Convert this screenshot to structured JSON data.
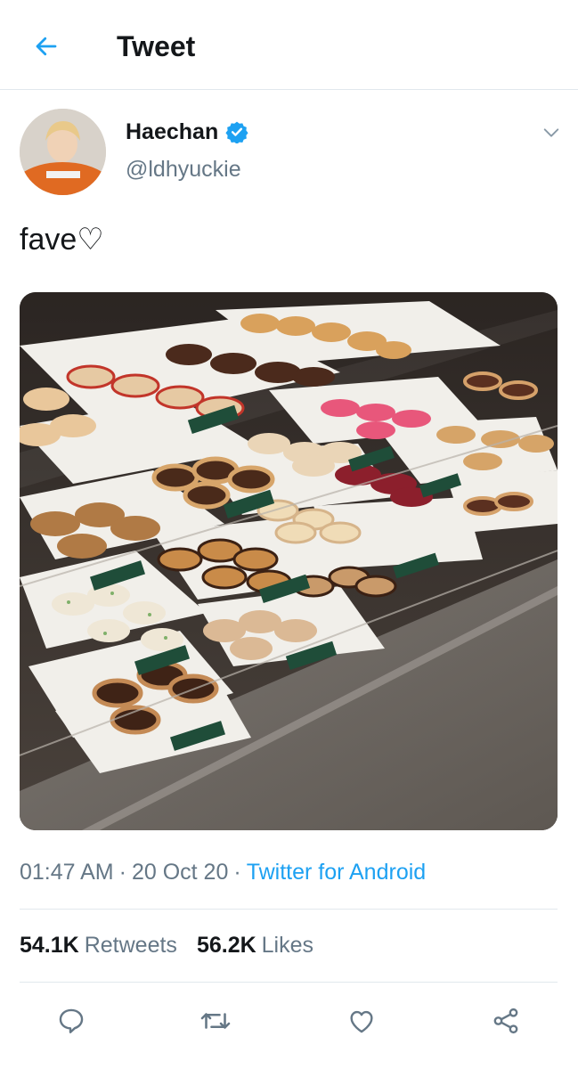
{
  "header": {
    "title": "Tweet",
    "back_icon": "arrow-left-icon"
  },
  "colors": {
    "accent": "#1da1f2",
    "text_primary": "#14171a",
    "text_secondary": "#657786",
    "divider": "#e1e8ed"
  },
  "author": {
    "name": "Haechan",
    "handle": "@ldhyuckie",
    "verified": true
  },
  "tweet": {
    "text": "fave♡",
    "media_type": "photo"
  },
  "meta": {
    "time": "01:47 AM",
    "separator": "·",
    "date": "20 Oct 20",
    "source": "Twitter for Android"
  },
  "stats": {
    "retweets_count": "54.1K",
    "retweets_label": "Retweets",
    "likes_count": "56.2K",
    "likes_label": "Likes"
  },
  "actions": [
    {
      "name": "reply",
      "icon": "reply-icon"
    },
    {
      "name": "retweet",
      "icon": "retweet-icon"
    },
    {
      "name": "like",
      "icon": "heart-icon"
    },
    {
      "name": "share",
      "icon": "share-icon"
    }
  ]
}
